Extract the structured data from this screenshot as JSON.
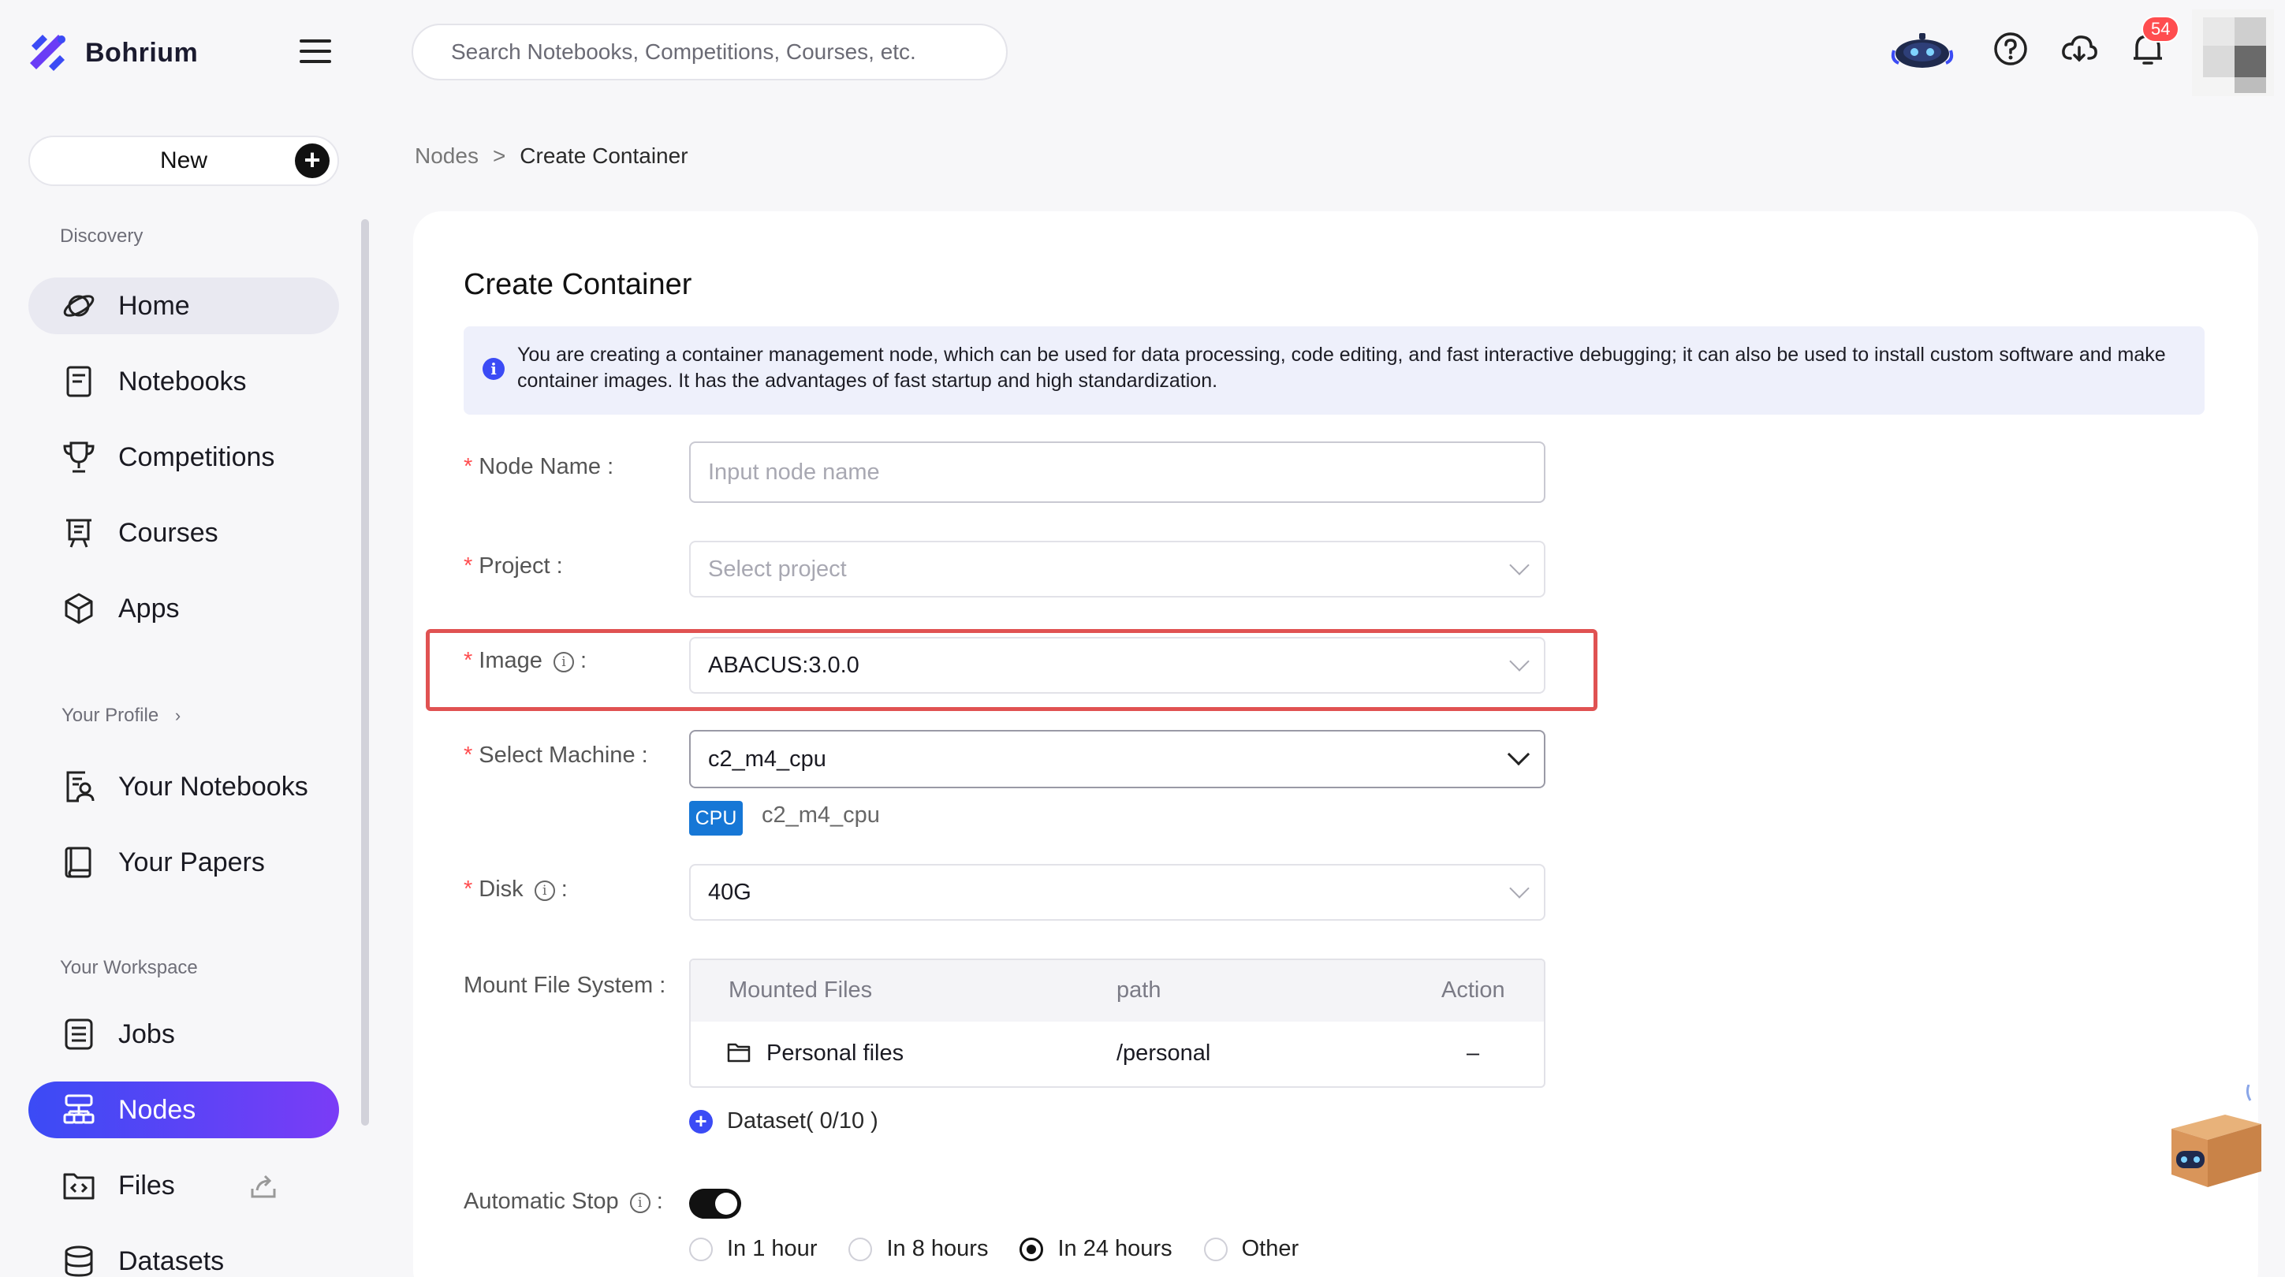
{
  "app": {
    "name": "Bohrium",
    "brand_color": "#3b4bf5",
    "accent_gradient": [
      "#3b4bf5",
      "#7a3cf6"
    ]
  },
  "header": {
    "search_placeholder": "Search Notebooks, Competitions, Courses, etc.",
    "notification_count": "54",
    "icons": [
      "robot-assistant-icon",
      "help-icon",
      "cloud-download-icon",
      "bell-icon"
    ]
  },
  "sidebar": {
    "new_label": "New",
    "discovery_label": "Discovery",
    "discovery_items": [
      {
        "label": "Home",
        "icon": "planet-icon"
      },
      {
        "label": "Notebooks",
        "icon": "notebook-icon"
      },
      {
        "label": "Competitions",
        "icon": "trophy-icon"
      },
      {
        "label": "Courses",
        "icon": "courses-icon"
      },
      {
        "label": "Apps",
        "icon": "cube-icon"
      }
    ],
    "profile_label": "Your Profile",
    "profile_items": [
      {
        "label": "Your Notebooks",
        "icon": "user-notebook-icon"
      },
      {
        "label": "Your Papers",
        "icon": "book-icon"
      }
    ],
    "workspace_label": "Your Workspace",
    "workspace_items": [
      {
        "label": "Jobs",
        "icon": "jobs-list-icon"
      },
      {
        "label": "Nodes",
        "icon": "nodes-icon",
        "active": true
      },
      {
        "label": "Files",
        "icon": "folder-code-icon"
      },
      {
        "label": "Datasets",
        "icon": "database-icon"
      }
    ]
  },
  "breadcrumb": {
    "parent": "Nodes",
    "separator": ">",
    "current": "Create Container"
  },
  "form": {
    "title": "Create Container",
    "info_text": "You are creating a container management node, which can be used for data processing, code editing, and fast interactive debugging; it can also be used to install custom software and make container images. It has the advantages of fast startup and high standardization.",
    "node_name": {
      "label": "Node Name",
      "placeholder": "Input node name"
    },
    "project": {
      "label": "Project",
      "placeholder": "Select project"
    },
    "image": {
      "label": "Image",
      "value": "ABACUS:3.0.0"
    },
    "machine": {
      "label": "Select Machine",
      "value": "c2_m4_cpu",
      "tag": "CPU",
      "tag_name": "c2_m4_cpu"
    },
    "disk": {
      "label": "Disk",
      "value": "40G"
    },
    "mount": {
      "label": "Mount File System",
      "columns": [
        "Mounted Files",
        "path",
        "Action"
      ],
      "rows": [
        {
          "name": "Personal files",
          "path": "/personal",
          "action": "–"
        }
      ],
      "dataset_label": "Dataset( 0/10 )"
    },
    "auto_stop": {
      "label": "Automatic Stop",
      "enabled": true,
      "options": [
        "In 1 hour",
        "In 8 hours",
        "In 24 hours",
        "Other"
      ],
      "selected": "In 24 hours"
    }
  }
}
